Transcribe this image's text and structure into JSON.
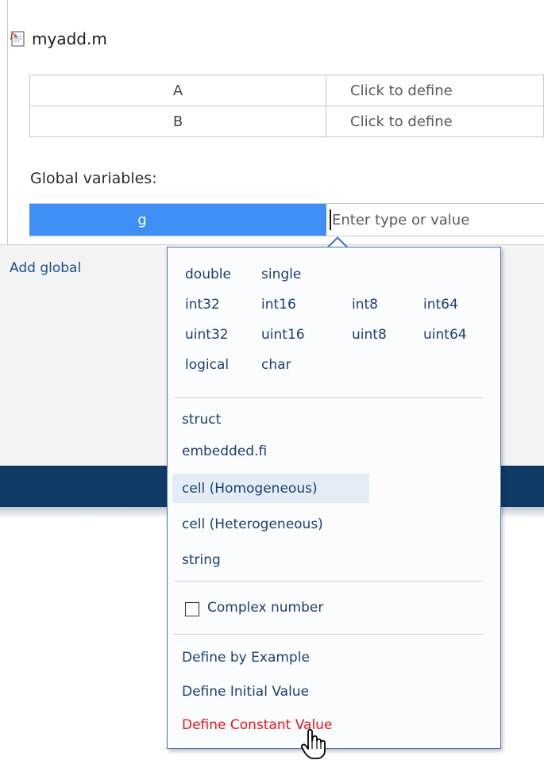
{
  "file": {
    "name": "myadd.m",
    "icon": "function-file-icon"
  },
  "arguments": [
    {
      "name": "A",
      "type": "Click to define"
    },
    {
      "name": "B",
      "type": "Click to define"
    }
  ],
  "globals": {
    "label": "Global variables:",
    "rows": [
      {
        "name": "g",
        "type_placeholder": "Enter type or value"
      }
    ],
    "add_label": "Add global"
  },
  "type_menu": {
    "numeric_types": [
      "double",
      "single",
      "int32",
      "int16",
      "int8",
      "int64",
      "uint32",
      "uint16",
      "uint8",
      "uint64",
      "logical",
      "char"
    ],
    "compound_types": [
      "struct",
      "embedded.fi",
      "cell (Homogeneous)",
      "cell (Heterogeneous)",
      "string"
    ],
    "complex_checkbox": {
      "label": "Complex number",
      "checked": false
    },
    "define_actions": [
      "Define by Example",
      "Define Initial Value",
      "Define Constant Value"
    ],
    "hovered": "cell (Homogeneous)",
    "active": "Define Constant Value",
    "colors": {
      "item": "#1c3f6e",
      "active": "#e8141c",
      "selection": "#3d8ff3"
    }
  }
}
